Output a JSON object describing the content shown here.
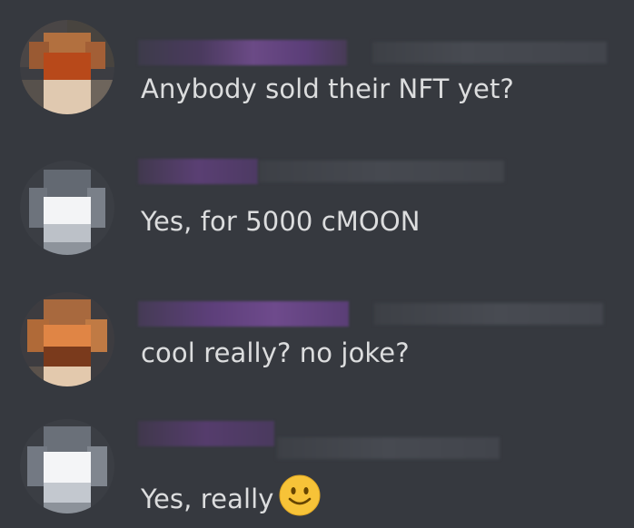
{
  "messages": [
    {
      "text": "Anybody sold their NFT yet?",
      "avatar_color": "#c4632a"
    },
    {
      "text": "Yes, for 5000 cMOON",
      "avatar_color": "#c9ced6"
    },
    {
      "text": "cool really? no joke?",
      "avatar_color": "#d47a3a"
    },
    {
      "text": "Yes, really",
      "avatar_color": "#d2d6dc",
      "emoji": "slightly-smiling-face-icon"
    }
  ],
  "colors": {
    "background": "#36393f",
    "message_text": "#dcddde",
    "username_redacted": "#6b4a86",
    "timestamp_redacted": "#454950"
  }
}
